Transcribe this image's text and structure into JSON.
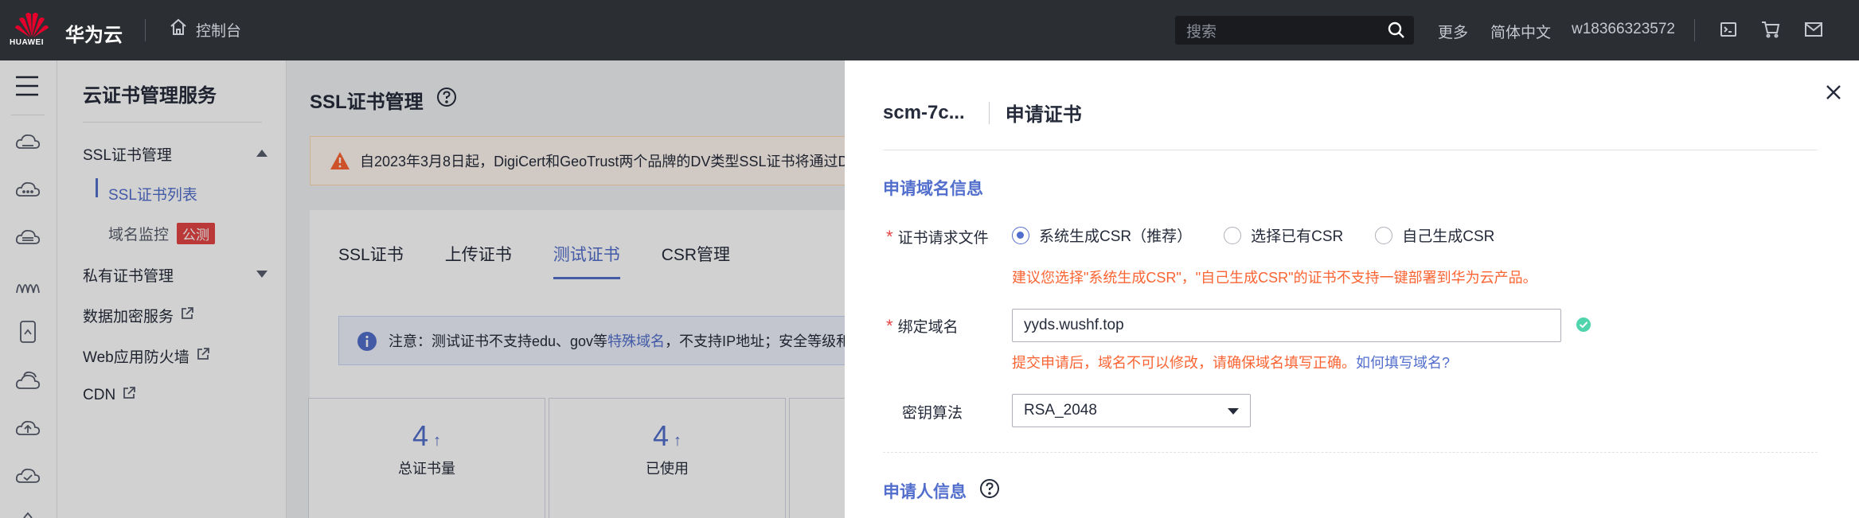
{
  "topbar": {
    "logo_text": "HUAWEI",
    "brand": "华为云",
    "console": "控制台",
    "search_placeholder": "搜索",
    "more": "更多",
    "language": "简体中文",
    "user": "w18366323572"
  },
  "sidebar": {
    "title": "云证书管理服务",
    "items": [
      {
        "label": "SSL证书管理"
      },
      {
        "label": "SSL证书列表"
      },
      {
        "label": "域名监控",
        "badge": "公测"
      },
      {
        "label": "私有证书管理"
      },
      {
        "label": "数据加密服务"
      },
      {
        "label": "Web应用防火墙"
      },
      {
        "label": "CDN"
      }
    ]
  },
  "main": {
    "title": "SSL证书管理",
    "notice": "自2023年3月8日起，DigiCert和GeoTrust两个品牌的DV类型SSL证书将通过D",
    "tabs": [
      "SSL证书",
      "上传证书",
      "测试证书",
      "CSR管理"
    ],
    "active_tab": 2,
    "info_prefix": "注意：测试证书不支持edu、gov等",
    "info_link": "特殊域名",
    "info_suffix": "，不支持IP地址；安全等级和",
    "stats": [
      {
        "value": "4",
        "label": "总证书量"
      },
      {
        "value": "4",
        "label": "已使用"
      }
    ]
  },
  "drawer": {
    "cert_id": "scm-7c...",
    "title": "申请证书",
    "section1": "申请域名信息",
    "csr_label": "证书请求文件",
    "csr_options": [
      "系统生成CSR（推荐）",
      "选择已有CSR",
      "自己生成CSR"
    ],
    "csr_selected": 0,
    "csr_hint": "建议您选择\"系统生成CSR\"，\"自己生成CSR\"的证书不支持一键部署到华为云产品。",
    "domain_label": "绑定域名",
    "domain_value": "yyds.wushf.top",
    "domain_hint": "提交申请后，域名不可以修改，请确保域名填写正确。",
    "domain_hint_link": "如何填写域名?",
    "algo_label": "密钥算法",
    "algo_value": "RSA_2048",
    "section2": "申请人信息"
  },
  "colors": {
    "accent": "#526ecc",
    "warning": "#fa6433",
    "danger": "#e54545",
    "topbar": "#2b2e33",
    "success": "#50d4ab"
  }
}
